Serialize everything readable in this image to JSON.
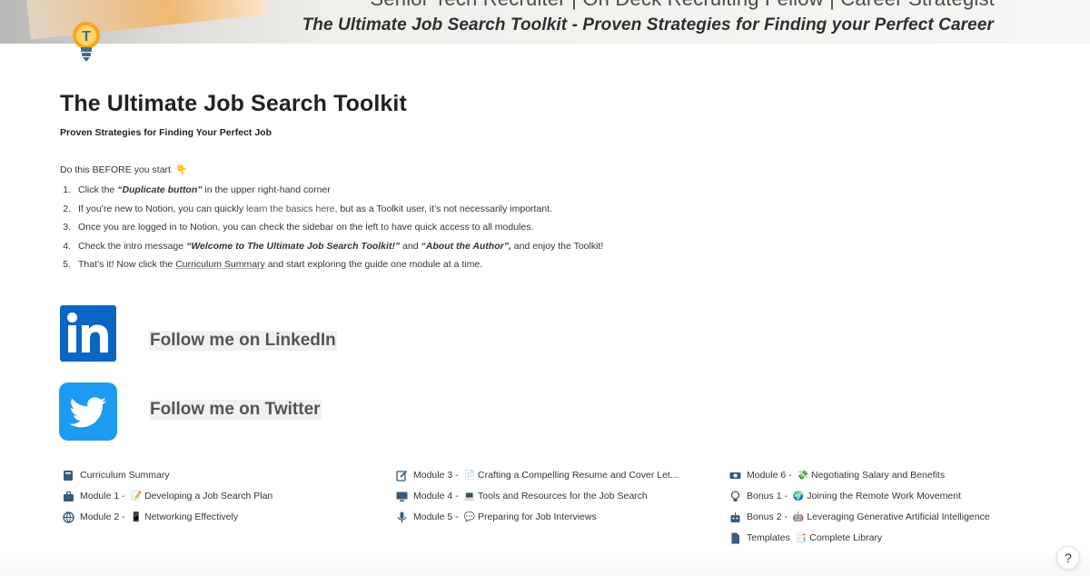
{
  "cover": {
    "top_text": "Senior Tech Recruiter | On Deck Recruiting Fellow | Career Strategist",
    "title": "The Ultimate Job Search Toolkit  - Proven Strategies for Finding your Perfect Career"
  },
  "page_icon": "lightbulb-icon",
  "page": {
    "title": "The Ultimate Job Search Toolkit",
    "subtitle": "Proven Strategies for Finding Your Perfect Job",
    "intro": "Do this BEFORE you start",
    "intro_emoji": "👇"
  },
  "steps": [
    {
      "num": "1.",
      "a": "Click the ",
      "b": "“Duplicate button”",
      "c": " in the upper right-hand corner"
    },
    {
      "num": "2.",
      "a": "If you’re new to Notion, you can quickly ",
      "link": "learn the basics here",
      "c": ", but as a Toolkit user, it’s not necessarily important."
    },
    {
      "num": "3.",
      "a": "Once you are logged in to Notion, you can check the sidebar on the left to have quick access to all modules."
    },
    {
      "num": "4.",
      "a": "Check the intro message ",
      "b": "“Welcome to The Ultimate Job Search Toolkit!”",
      "c": " and ",
      "d": "“About the Author”,",
      "e": " and enjoy the Toolkit!"
    },
    {
      "num": "5.",
      "a": "That’s it! Now click the ",
      "link": "Curriculum Summary",
      "c": " and start exploring the guide one module at a time."
    }
  ],
  "social": {
    "linkedin_label": "Follow me on LinkedIn",
    "twitter_label": "Follow me on Twitter",
    "linkedin_icon": "linkedin-logo-icon",
    "twitter_icon": "twitter-logo-icon"
  },
  "modules": {
    "col1": [
      {
        "icon": "book-icon",
        "label": "Curriculum Summary"
      },
      {
        "icon": "briefcase-icon",
        "label": "Module 1 - ",
        "emoji": "📝",
        "rest": "Developing a Job Search Plan"
      },
      {
        "icon": "globe-icon",
        "label": "Module 2 - ",
        "emoji": "📱",
        "rest": "Networking Effectively"
      }
    ],
    "col2": [
      {
        "icon": "edit-icon",
        "label": "Module 3 - ",
        "emoji": "📄",
        "rest": "Crafting a Compelling Resume and Cover Let..."
      },
      {
        "icon": "monitor-icon",
        "label": "Module 4 - ",
        "emoji": "💻",
        "rest": "Tools and Resources for the Job Search"
      },
      {
        "icon": "microphone-icon",
        "label": "Module 5 - ",
        "emoji": "💬",
        "rest": "Preparing for Job Interviews"
      }
    ],
    "col3": [
      {
        "icon": "money-icon",
        "label": "Module 6 - ",
        "emoji": "💸",
        "rest": "Negotiating Salary and Benefits"
      },
      {
        "icon": "lightbulb-small-icon",
        "label": "Bonus 1 - ",
        "emoji": "🌍",
        "rest": "Joining the Remote Work Movement"
      },
      {
        "icon": "robot-icon",
        "label": "Bonus 2 - ",
        "emoji": "🤖",
        "rest": "Leveraging Generative Artificial Intelligence"
      },
      {
        "icon": "document-icon",
        "label": "Templates ",
        "emoji": "📑",
        "rest": "Complete Library"
      }
    ]
  },
  "help": {
    "label": "?"
  },
  "colors": {
    "linkedin": "#0a66c2",
    "twitter": "#1d9bf0",
    "icon_blue": "#3a5a78"
  }
}
